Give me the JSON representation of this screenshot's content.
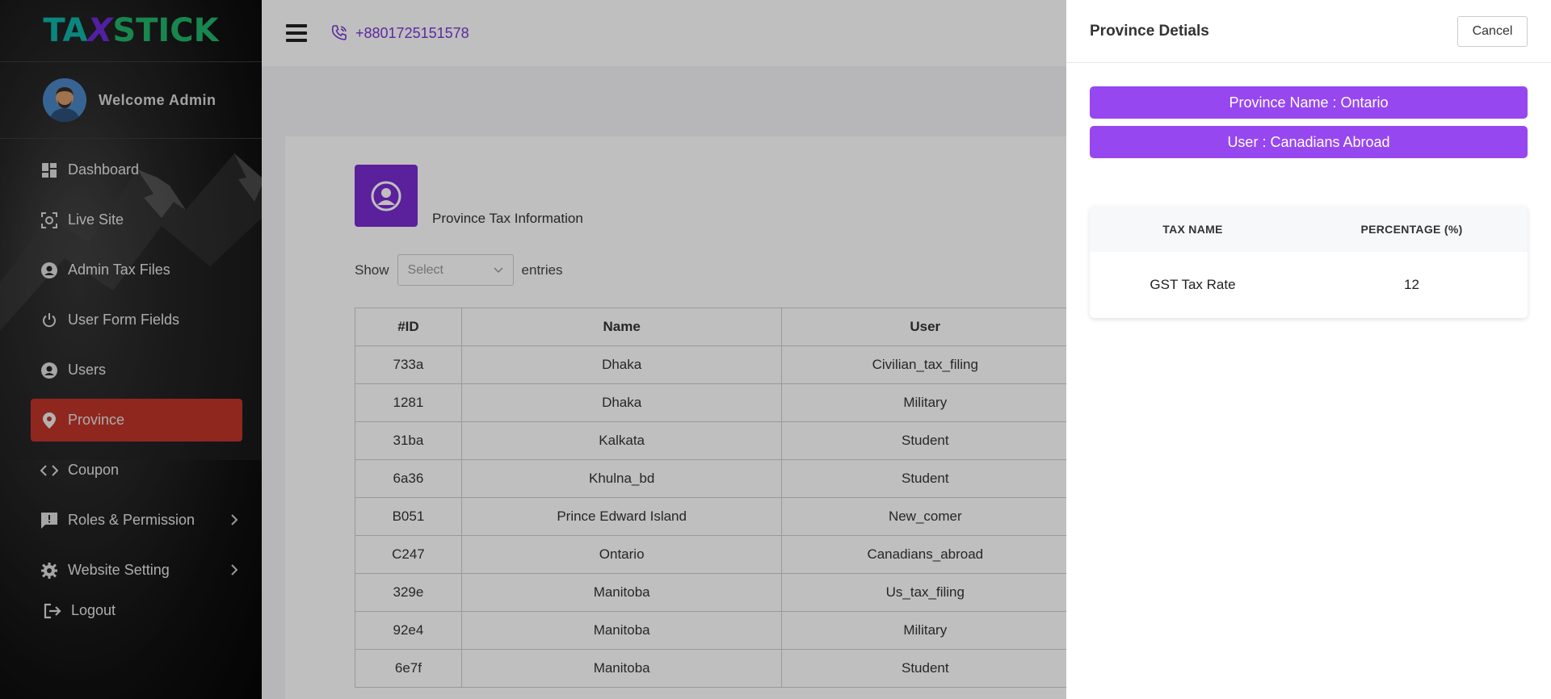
{
  "brand": {
    "logo_ta": "TA",
    "logo_x": "X",
    "logo_stick": "STICK"
  },
  "sidebar": {
    "welcome": "Welcome Admin",
    "items": [
      {
        "label": "Dashboard"
      },
      {
        "label": "Live Site"
      },
      {
        "label": "Admin Tax Files"
      },
      {
        "label": "User Form Fields"
      },
      {
        "label": "Users"
      },
      {
        "label": "Province"
      },
      {
        "label": "Coupon"
      },
      {
        "label": "Roles & Permission"
      },
      {
        "label": "Website Setting"
      },
      {
        "label": "Logout"
      }
    ],
    "active_color": "#c0342a"
  },
  "topbar": {
    "phone": "+8801725151578"
  },
  "page": {
    "title": "Province Tax Information",
    "show_label": "Show",
    "select_placeholder": "Select",
    "entries_label": "entries"
  },
  "table": {
    "headers": {
      "id": "#ID",
      "name": "Name",
      "user": "User"
    },
    "rows": [
      {
        "id": "733a",
        "name": "Dhaka",
        "user": "Civilian_tax_filing"
      },
      {
        "id": "1281",
        "name": "Dhaka",
        "user": "Military"
      },
      {
        "id": "31ba",
        "name": "Kalkata",
        "user": "Student"
      },
      {
        "id": "6a36",
        "name": "Khulna_bd",
        "user": "Student"
      },
      {
        "id": "B051",
        "name": "Prince Edward Island",
        "user": "New_comer"
      },
      {
        "id": "C247",
        "name": "Ontario",
        "user": "Canadians_abroad"
      },
      {
        "id": "329e",
        "name": "Manitoba",
        "user": "Us_tax_filing"
      },
      {
        "id": "92e4",
        "name": "Manitoba",
        "user": "Military"
      },
      {
        "id": "6e7f",
        "name": "Manitoba",
        "user": "Student"
      }
    ]
  },
  "drawer": {
    "title": "Province Detials",
    "cancel": "Cancel",
    "province_name": "Province Name : Ontario",
    "user": "User : Canadians Abroad",
    "tax_headers": {
      "name": "TAX NAME",
      "percentage": "PERCENTAGE (%)"
    },
    "tax_rows": [
      {
        "name": "GST Tax Rate",
        "percentage": "12"
      }
    ],
    "accent": "#9747f0"
  }
}
